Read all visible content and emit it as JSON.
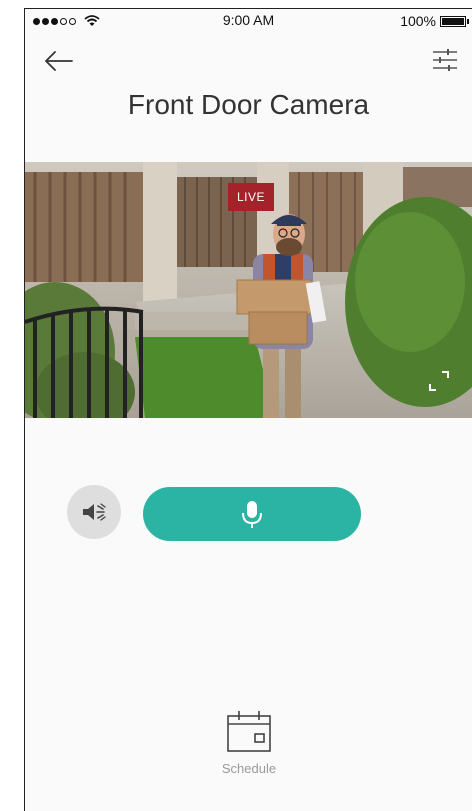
{
  "status_bar": {
    "time": "9:00 AM",
    "battery": "100%",
    "signal_bars_full": 3,
    "signal_bars_total": 5
  },
  "header": {
    "title": "Front Door Camera",
    "back_icon": "arrow-left-icon",
    "settings_icon": "sliders-icon"
  },
  "feed": {
    "badge": "LIVE"
  },
  "controls": {
    "mute_icon": "speaker-muted-icon",
    "talk_icon": "microphone-icon"
  },
  "schedule": {
    "label": "Schedule",
    "icon": "calendar-icon"
  },
  "colors": {
    "accent": "#2bb3a4",
    "live": "#a4232b",
    "mute_bg": "#dedede"
  }
}
